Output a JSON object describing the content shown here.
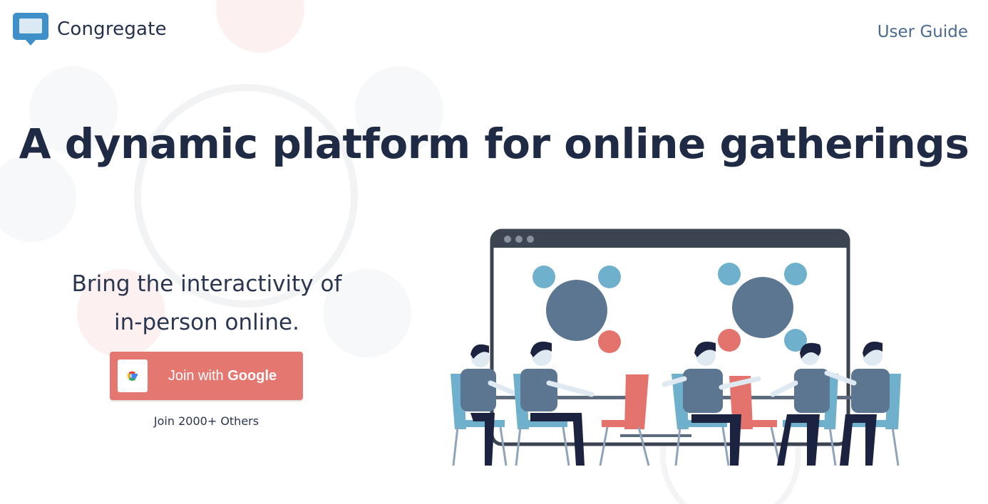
{
  "header": {
    "brand_name": "Congregate",
    "brand_icon": "speech-bubble-icon",
    "nav_link": "User Guide"
  },
  "hero": {
    "title": "A dynamic platform for online gatherings",
    "tagline_line1": "Bring the interactivity of",
    "tagline_line2": "in-person online."
  },
  "cta": {
    "button_prefix": "Join with ",
    "button_brand": "Google",
    "button_icon": "google-g-icon",
    "join_count": "Join 2000+ Others"
  },
  "colors": {
    "primary_text": "#1f2a44",
    "accent_button": "#e57771",
    "link": "#4a6b8f",
    "logo_blue": "#3f8fc9",
    "illustration_slate": "#5c7590",
    "illustration_light_blue": "#6fb1cc",
    "illustration_coral": "#e4736d"
  },
  "illustration": {
    "icon": "meeting-illustration"
  }
}
